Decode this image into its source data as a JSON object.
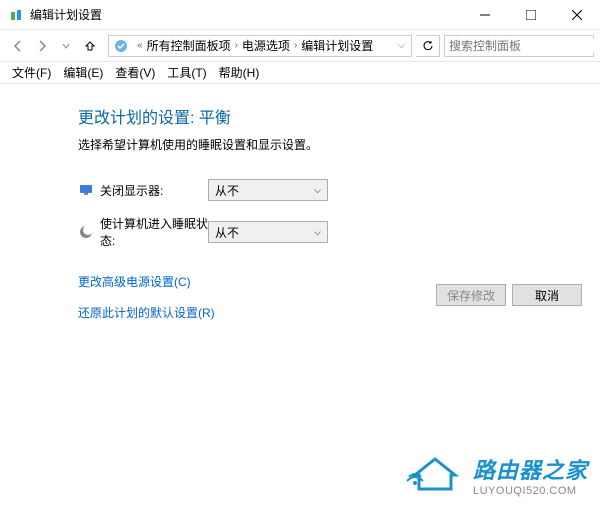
{
  "titlebar": {
    "title": "编辑计划设置"
  },
  "breadcrumb": {
    "items": [
      "所有控制面板项",
      "电源选项",
      "编辑计划设置"
    ]
  },
  "search": {
    "placeholder": "搜索控制面板"
  },
  "menu": {
    "file": "文件(F)",
    "edit": "编辑(E)",
    "view": "查看(V)",
    "tools": "工具(T)",
    "help": "帮助(H)"
  },
  "page": {
    "title": "更改计划的设置: 平衡",
    "subtitle": "选择希望计算机使用的睡眠设置和显示设置。"
  },
  "settings": {
    "display_off": {
      "label": "关闭显示器:",
      "value": "从不"
    },
    "sleep": {
      "label": "使计算机进入睡眠状态:",
      "value": "从不"
    }
  },
  "links": {
    "advanced": "更改高级电源设置(C)",
    "restore": "还原此计划的默认设置(R)"
  },
  "buttons": {
    "save": "保存修改",
    "cancel": "取消"
  },
  "watermark": {
    "title": "路由器之家",
    "url": "LUYOUQI520.COM"
  }
}
